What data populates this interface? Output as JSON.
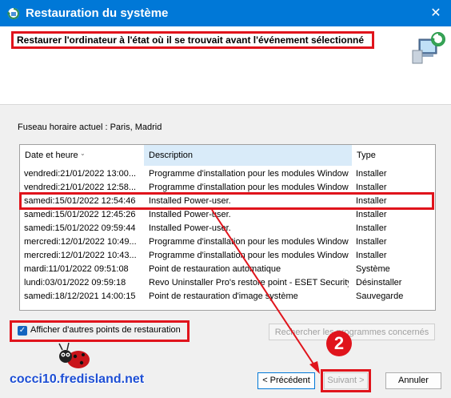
{
  "window": {
    "title": "Restauration du système",
    "close_glyph": "✕"
  },
  "header": {
    "instruction": "Restaurer l'ordinateur à l'état où il se trouvait avant l'événement sélectionné"
  },
  "timezone_label": "Fuseau horaire actuel : Paris, Madrid",
  "table": {
    "columns": [
      "Date et heure",
      "Description",
      "Type"
    ],
    "rows": [
      {
        "date": "vendredi:21/01/2022 13:00...",
        "description": "Programme d'installation pour les modules Windows",
        "type": "Installer"
      },
      {
        "date": "vendredi:21/01/2022 12:58...",
        "description": "Programme d'installation pour les modules Windows",
        "type": "Installer"
      },
      {
        "date": "samedi:15/01/2022 12:54:46",
        "description": "Installed Power-user.",
        "type": "Installer"
      },
      {
        "date": "samedi:15/01/2022 12:45:26",
        "description": "Installed Power-user.",
        "type": "Installer"
      },
      {
        "date": "samedi:15/01/2022 09:59:44",
        "description": "Installed Power-user.",
        "type": "Installer"
      },
      {
        "date": "mercredi:12/01/2022 10:49...",
        "description": "Programme d'installation pour les modules Windows",
        "type": "Installer"
      },
      {
        "date": "mercredi:12/01/2022 10:43...",
        "description": "Programme d'installation pour les modules Windows",
        "type": "Installer"
      },
      {
        "date": "mardi:11/01/2022 09:51:08",
        "description": "Point de restauration automatique",
        "type": "Système"
      },
      {
        "date": "lundi:03/01/2022 09:59:18",
        "description": "Revo Uninstaller Pro's restore point - ESET Security",
        "type": "Désinstaller"
      },
      {
        "date": "samedi:18/12/2021 14:00:15",
        "description": "Point de restauration d'image système",
        "type": "Sauvegarde"
      }
    ],
    "selected_index": 2
  },
  "checkbox": {
    "label": "Afficher d'autres points de restauration",
    "checked": true
  },
  "scan_button": "Rechercher les programmes concernés",
  "buttons": {
    "previous": "< Précédent",
    "next": "Suivant >",
    "cancel": "Annuler"
  },
  "step_badge": "2",
  "watermark": "cocci10.fredisland.net",
  "colors": {
    "titlebar": "#0078d7",
    "highlight": "#e0141c",
    "accent_header": "#d9ebf9"
  }
}
